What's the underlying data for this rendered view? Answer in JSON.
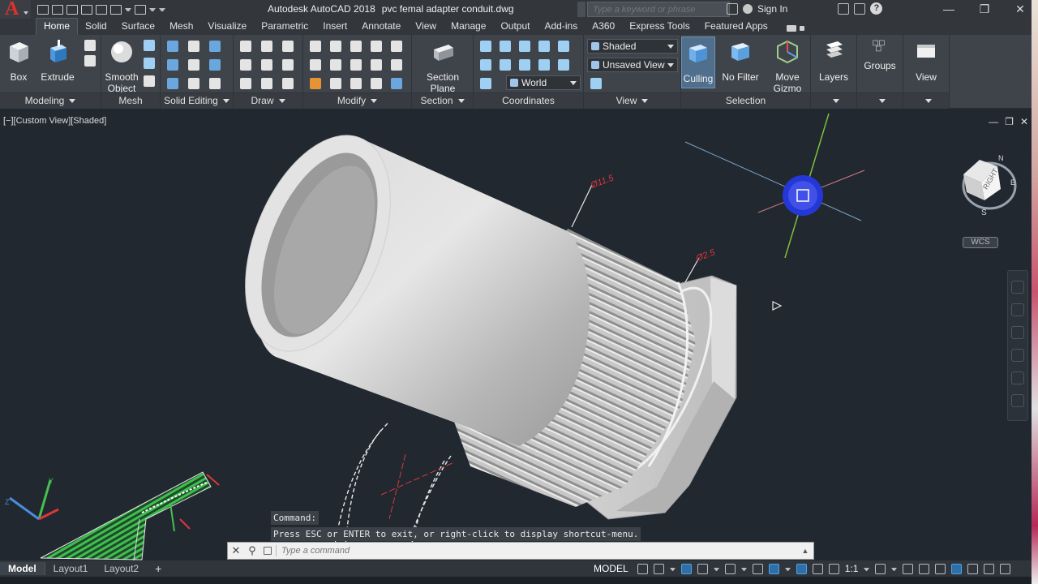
{
  "titlebar": {
    "app": "Autodesk AutoCAD 2018",
    "file": "pvc femal adapter conduit.dwg",
    "search_placeholder": "Type a keyword or phrase",
    "signin": "Sign In"
  },
  "tabs": [
    "Home",
    "Solid",
    "Surface",
    "Mesh",
    "Visualize",
    "Parametric",
    "Insert",
    "Annotate",
    "View",
    "Manage",
    "Output",
    "Add-ins",
    "A360",
    "Express Tools",
    "Featured Apps"
  ],
  "ribbon": {
    "box": "Box",
    "extrude": "Extrude",
    "smooth1": "Smooth",
    "smooth2": "Object",
    "section1": "Section",
    "section2": "Plane",
    "visual_style": "Shaded",
    "named_view": "Unsaved View",
    "ucs": "World",
    "culling": "Culling",
    "nofilter": "No Filter",
    "move1": "Move",
    "move2": "Gizmo",
    "layers": "Layers",
    "groups": "Groups",
    "view": "View",
    "panels": {
      "modeling": "Modeling",
      "mesh": "Mesh",
      "solid_editing": "Solid Editing",
      "draw": "Draw",
      "modify": "Modify",
      "section": "Section",
      "coordinates": "Coordinates",
      "view": "View",
      "selection": "Selection"
    }
  },
  "viewport": {
    "label": "[−][Custom View][Shaded]",
    "dims": [
      "Ø11.5",
      "Ø2.5"
    ],
    "wcs": "WCS",
    "cube_face": "RIGHT",
    "compass": {
      "n": "N",
      "e": "E",
      "s": "S"
    }
  },
  "command": {
    "history": [
      "Command:",
      "Press ESC or ENTER to exit, or right-click to display shortcut-menu."
    ],
    "placeholder": "Type a command"
  },
  "statusbar": {
    "layouts": [
      "Model",
      "Layout1",
      "Layout2"
    ],
    "mode": "MODEL",
    "scale": "1:1"
  },
  "colors": {
    "accent": "#4fa3e6",
    "logo": "#e0302b",
    "hatch": "#2f9e3c",
    "dim": "#e0353a"
  }
}
